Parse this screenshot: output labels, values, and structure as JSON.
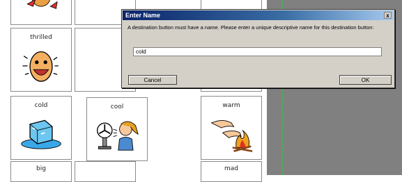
{
  "cards": {
    "thrilled": "thrilled",
    "cold": "cold",
    "cool": "cool",
    "warm": "warm",
    "big": "big",
    "mad": "mad"
  },
  "dialog": {
    "title": "Enter Name",
    "close_label": "x",
    "message": "A destination button must have a name.  Please enter a unique descriptive name for this destination button:",
    "input_value": "cold",
    "cancel_label": "Cancel",
    "ok_label": "OK"
  },
  "colors": {
    "title_bar": "#0a246a",
    "dialog_face": "#d4d0c8",
    "panel_gray": "#808080",
    "dashed_guide": "#2ecc40"
  }
}
